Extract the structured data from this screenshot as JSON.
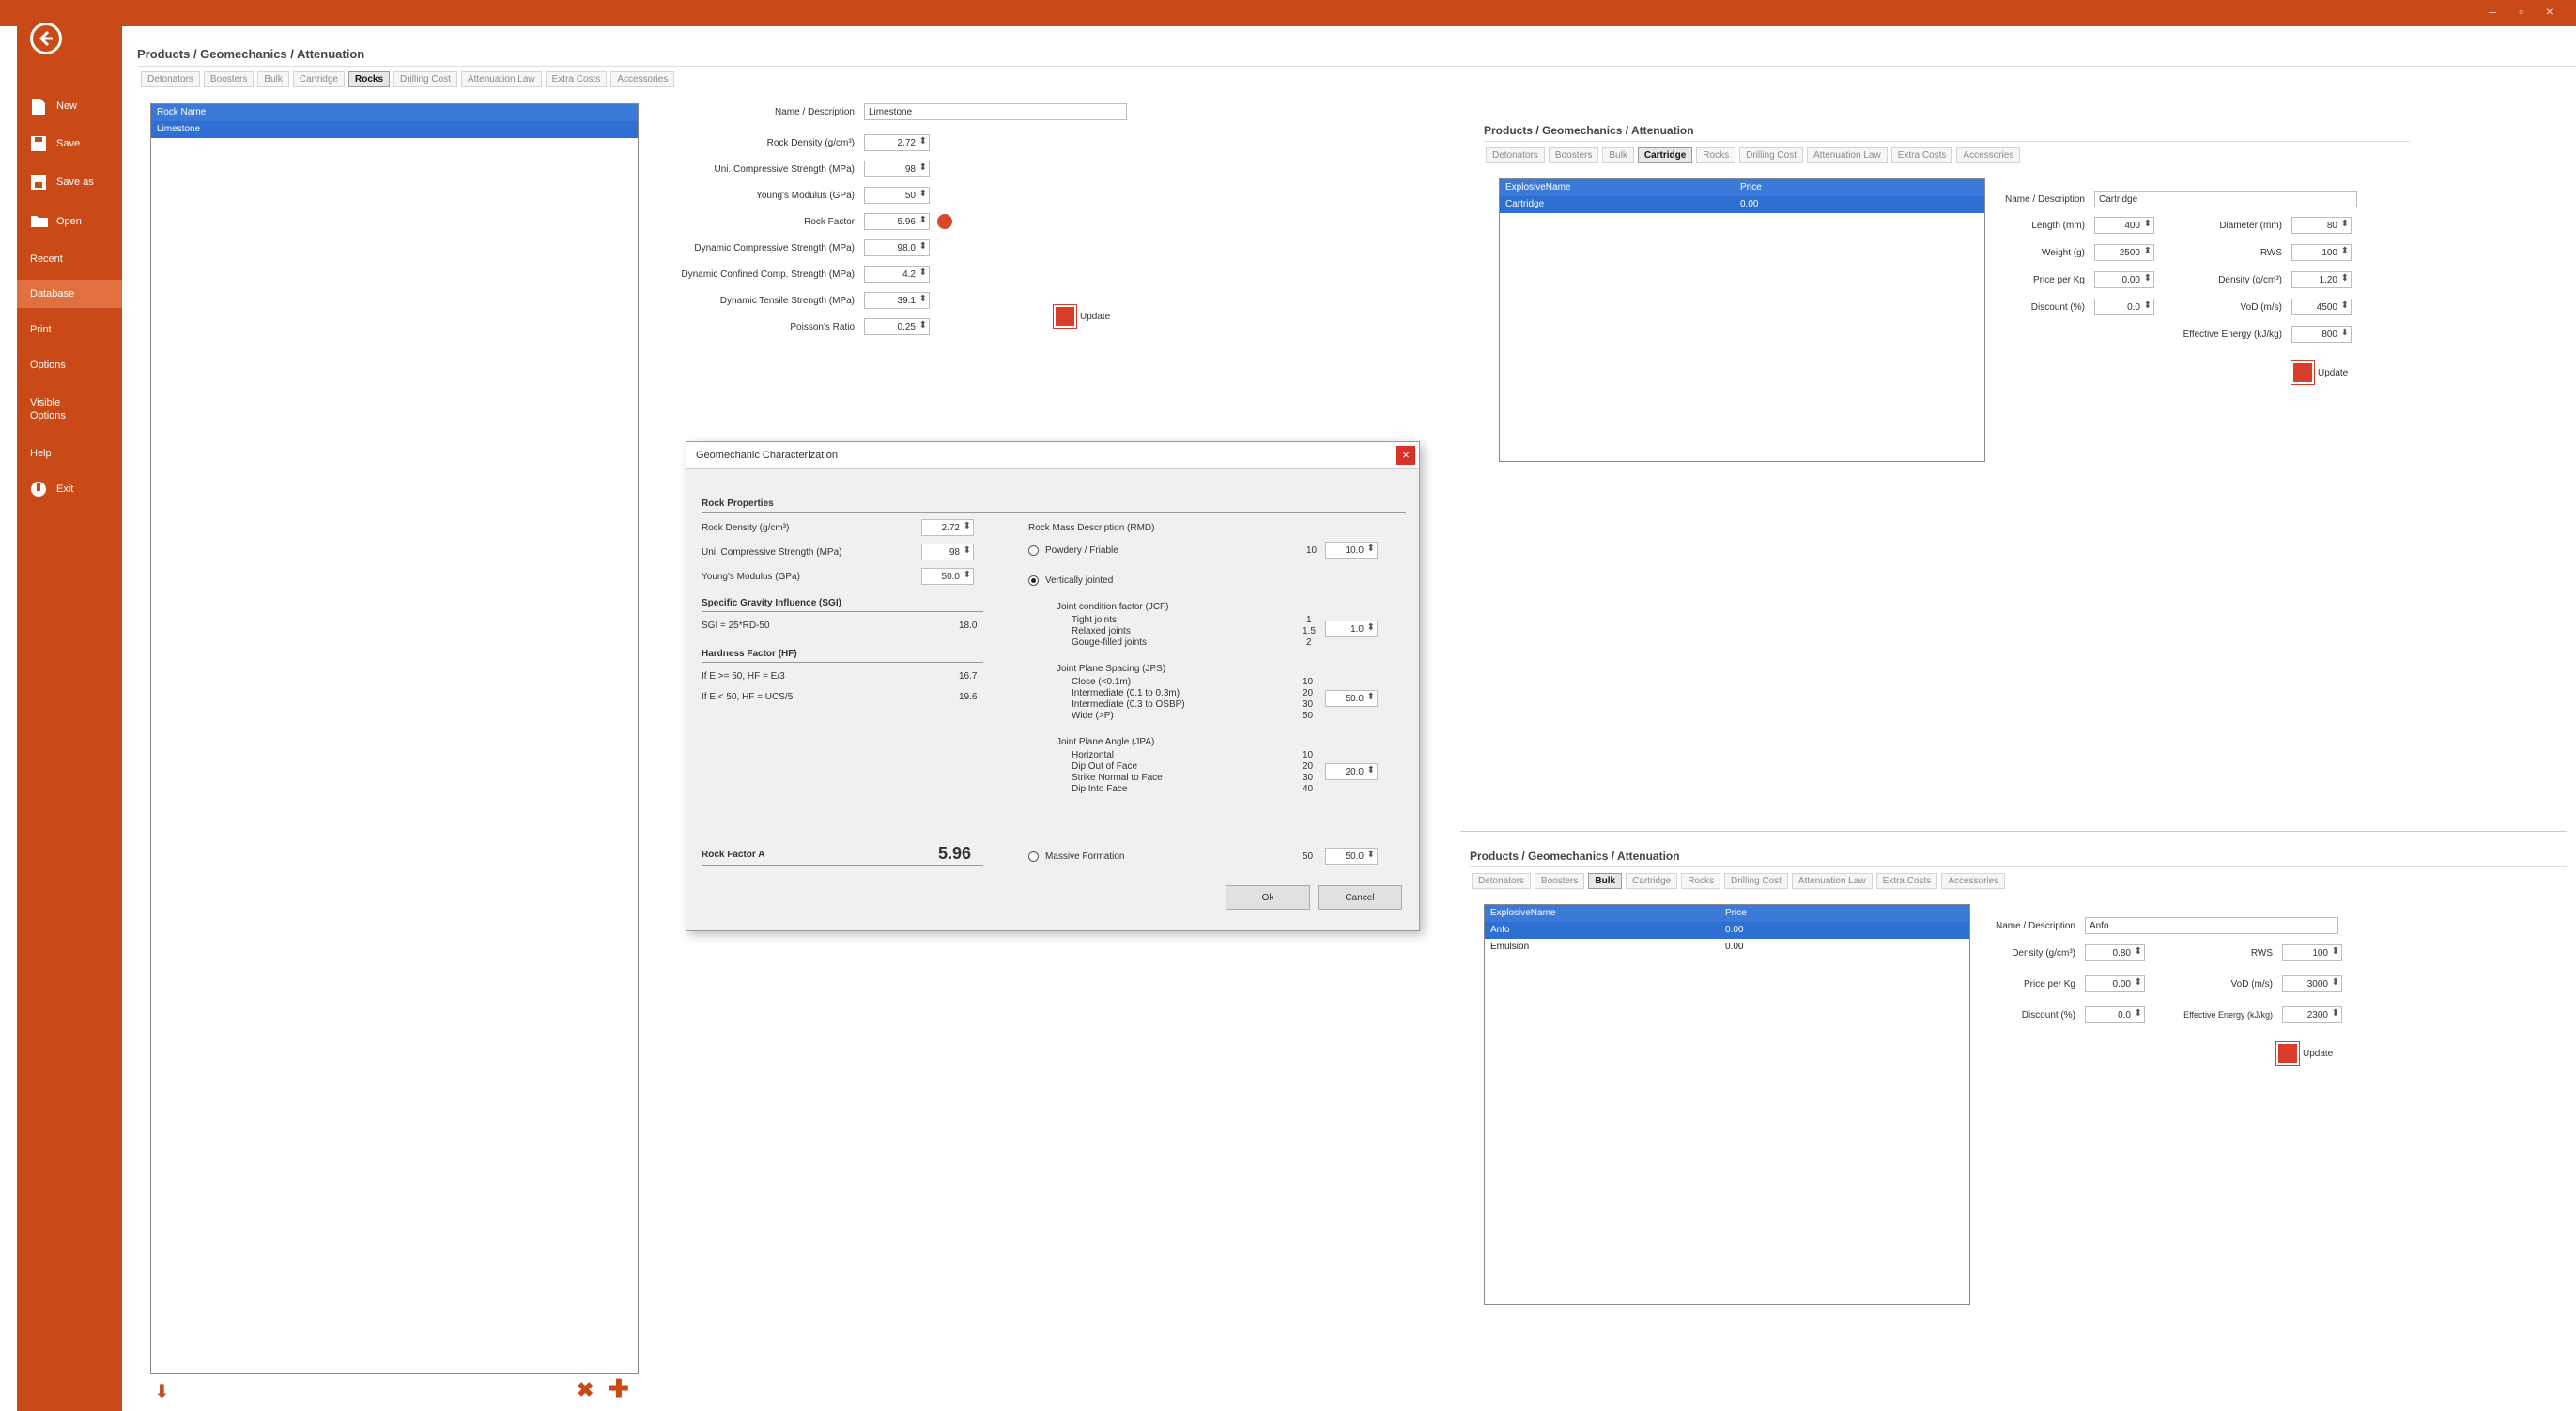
{
  "window": {
    "controls": "– ▫ ×"
  },
  "sidebar": {
    "items": [
      {
        "label": "New",
        "icon": "new-file-icon"
      },
      {
        "label": "Save",
        "icon": "save-icon"
      },
      {
        "label": "Save as",
        "icon": "save-as-icon"
      },
      {
        "label": "Open",
        "icon": "open-folder-icon"
      },
      {
        "label": "Recent"
      },
      {
        "label": "Database",
        "active": true
      },
      {
        "label": "Print"
      },
      {
        "label": "Options"
      },
      {
        "label": "Visible\nOptions"
      },
      {
        "label": "Help"
      },
      {
        "label": "Exit",
        "icon": "exit-icon"
      }
    ]
  },
  "main": {
    "breadcrumb": "Products / Geomechanics / Attenuation",
    "tabs": [
      "Detonators",
      "Boosters",
      "Bulk",
      "Cartridge",
      "Rocks",
      "Drilling Cost",
      "Attenuation Law",
      "Extra Costs",
      "Accessories"
    ],
    "selected_tab": "Rocks",
    "list": {
      "header": "Rock Name",
      "rows": [
        "Limestone"
      ]
    },
    "form": {
      "name_label": "Name / Description",
      "name_value": "Limestone",
      "fields": [
        {
          "label": "Rock Density (g/cm³)",
          "value": "2.72"
        },
        {
          "label": "Uni. Compressive Strength (MPa)",
          "value": "98"
        },
        {
          "label": "Young's Modulus (GPa)",
          "value": "50"
        },
        {
          "label": "Rock Factor",
          "value": "5.96"
        },
        {
          "label": "Dynamic Compressive Strength (MPa)",
          "value": "98.0"
        },
        {
          "label": "Dynamic Confined Comp. Strength (MPa)",
          "value": "4.2"
        },
        {
          "label": "Dynamic Tensile Strength (MPa)",
          "value": "39.1"
        },
        {
          "label": "Poisson's Ratio",
          "value": "0.25"
        }
      ],
      "update_label": "Update"
    },
    "bottom_icons": [
      "import-icon",
      "delete-icon",
      "add-icon"
    ]
  },
  "dialog": {
    "title": "Geomechanic Characterization",
    "close": "×",
    "rock_properties_title": "Rock Properties",
    "fields": [
      {
        "label": "Rock Density (g/cm³)",
        "value": "2.72"
      },
      {
        "label": "Uni. Compressive Strength (MPa)",
        "value": "98"
      },
      {
        "label": "Young's Modulus (GPa)",
        "value": "50.0"
      }
    ],
    "sgi_title": "Specific Gravity Influence (SGI)",
    "sgi_formula": "SGI = 25*RD-50",
    "sgi_value": "18.0",
    "hf_title": "Hardness Factor (HF)",
    "hf_rows": [
      {
        "label": "If E >= 50, HF = E/3",
        "value": "16.7"
      },
      {
        "label": "If E < 50, HF = UCS/5",
        "value": "19.6"
      }
    ],
    "rock_factor_label": "Rock Factor A",
    "rock_factor_value": "5.96",
    "rmd_title": "Rock Mass Description (RMD)",
    "rmd_powdery": "Powdery / Friable",
    "rmd_powdery_val": "10",
    "rmd_powdery_spin": "10.0",
    "rmd_jointed": "Vertically jointed",
    "jcf_title": "Joint condition factor (JCF)",
    "jcf_items": [
      "Tight joints",
      "Relaxed joints",
      "Gouge-filled joints"
    ],
    "jcf_vals": [
      "1",
      "1.5",
      "2"
    ],
    "jcf_spin": "1.0",
    "jps_title": "Joint Plane Spacing (JPS)",
    "jps_items": [
      "Close (<0.1m)",
      "Intermediate (0.1 to 0.3m)",
      "Intermediate (0.3 to OSBP)",
      "Wide (>P)"
    ],
    "jps_vals": [
      "10",
      "20",
      "30",
      "50"
    ],
    "jps_spin": "50.0",
    "jpa_title": "Joint Plane Angle (JPA)",
    "jpa_items": [
      "Horizontal",
      "Dip Out of Face",
      "Strike Normal to Face",
      "Dip Into Face"
    ],
    "jpa_vals": [
      "10",
      "20",
      "30",
      "40"
    ],
    "jpa_spin": "20.0",
    "rmd_massive": "Massive Formation",
    "rmd_massive_val": "50",
    "rmd_massive_spin": "50.0",
    "ok_label": "Ok",
    "cancel_label": "Cancel"
  },
  "panel_cartridge": {
    "breadcrumb": "Products / Geomechanics / Attenuation",
    "tabs": [
      "Detonators",
      "Boosters",
      "Bulk",
      "Cartridge",
      "Rocks",
      "Drilling Cost",
      "Attenuation Law",
      "Extra Costs",
      "Accessories"
    ],
    "selected_tab": "Cartridge",
    "list": {
      "headers": [
        "ExplosiveName",
        "Price"
      ],
      "rows": [
        [
          "Cartridge",
          "0.00"
        ]
      ]
    },
    "name_label": "Name / Description",
    "name_value": "Cartridge",
    "fields_left": [
      {
        "label": "Length (mm)",
        "value": "400"
      },
      {
        "label": "Weight (g)",
        "value": "2500"
      },
      {
        "label": "Price per Kg",
        "value": "0.00"
      },
      {
        "label": "Discount (%)",
        "value": "0.0"
      }
    ],
    "fields_right": [
      {
        "label": "Diameter (mm)",
        "value": "80"
      },
      {
        "label": "RWS",
        "value": "100"
      },
      {
        "label": "Density (g/cm³)",
        "value": "1.20"
      },
      {
        "label": "VoD (m/s)",
        "value": "4500"
      },
      {
        "label": "Effective Energy (kJ/kg)",
        "value": "800"
      }
    ],
    "update_label": "Update"
  },
  "panel_bulk": {
    "breadcrumb": "Products / Geomechanics / Attenuation",
    "tabs": [
      "Detonators",
      "Boosters",
      "Bulk",
      "Cartridge",
      "Rocks",
      "Drilling Cost",
      "Attenuation Law",
      "Extra Costs",
      "Accessories"
    ],
    "selected_tab": "Bulk",
    "list": {
      "headers": [
        "ExplosiveName",
        "Price"
      ],
      "rows": [
        [
          "Anfo",
          "0.00"
        ],
        [
          "Emulsion",
          "0.00"
        ]
      ]
    },
    "name_label": "Name / Description",
    "name_value": "Anfo",
    "fields_left": [
      {
        "label": "Density (g/cm³)",
        "value": "0.80"
      },
      {
        "label": "Price per Kg",
        "value": "0.00"
      },
      {
        "label": "Discount (%)",
        "value": "0.0"
      }
    ],
    "fields_right": [
      {
        "label": "RWS",
        "value": "100"
      },
      {
        "label": "VoD (m/s)",
        "value": "3000"
      },
      {
        "label": "Effective Energy (kJ/kg)",
        "value": "2300"
      }
    ],
    "update_label": "Update"
  },
  "colors": {
    "accent": "#c94a17",
    "selection": "#2d6fd3",
    "close": "#d9322a"
  }
}
